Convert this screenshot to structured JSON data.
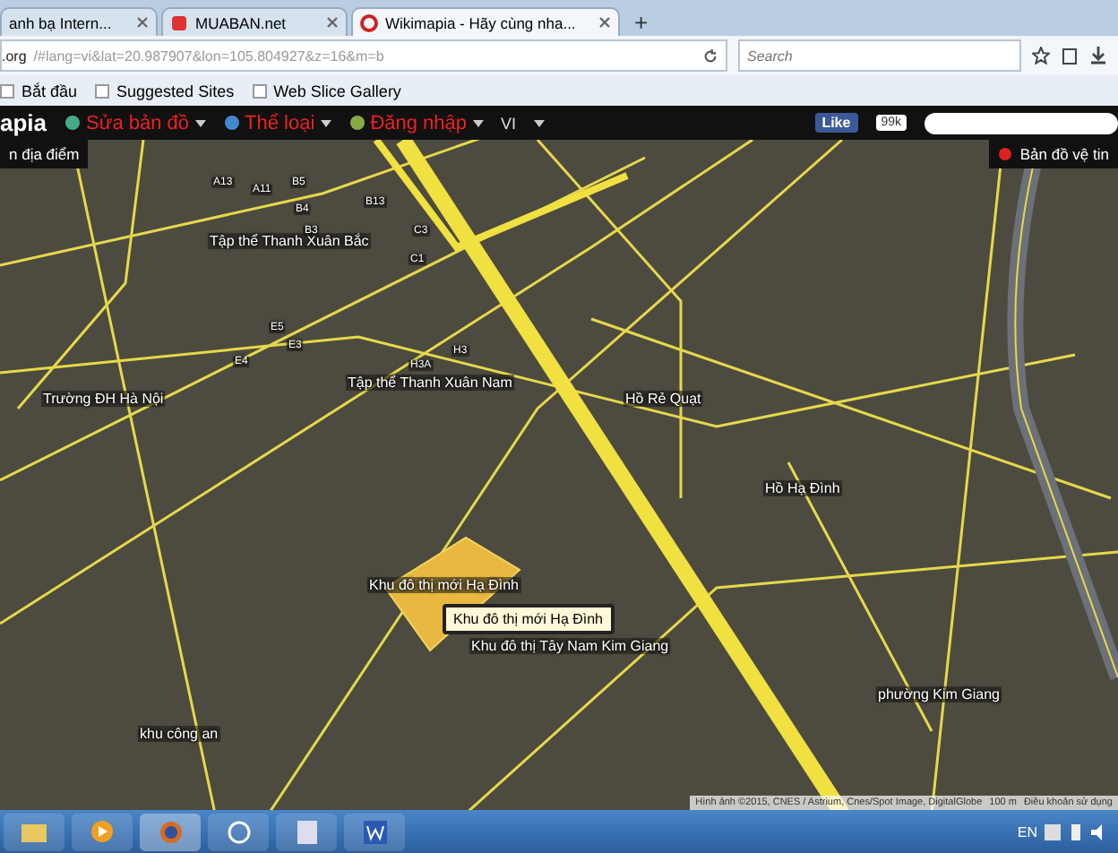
{
  "browser": {
    "tabs": [
      {
        "label": "anh bạ Intern...",
        "selected": false
      },
      {
        "label": "MUABAN.net",
        "selected": false
      },
      {
        "label": "Wikimapia - Hãy cùng nha...",
        "selected": true
      }
    ],
    "new_tab": "+",
    "address": {
      "host": ".org",
      "path": "/#lang=vi&lat=20.987907&lon=105.804927&z=16&m=b"
    },
    "search": {
      "placeholder": "Search"
    },
    "bookmarks": [
      "Bắt đầu",
      "Suggested Sites",
      "Web Slice Gallery"
    ]
  },
  "site_bar": {
    "logo": "apia",
    "menu": [
      "Sửa bản đồ",
      "Thể loại",
      "Đăng nhập"
    ],
    "language": "VI",
    "like": "Like",
    "like_count": "99k"
  },
  "map": {
    "left_button": "n địa điểm",
    "right_button": "Bản đồ vệ tin",
    "labels": [
      "Tập thể Thanh Xuân Bắc",
      "Tập thể Thanh Xuân Nam",
      "Trường ĐH Hà Nội",
      "Hồ Rẻ Quạt",
      "Hồ Hạ Đình",
      "Khu đô thị mới Hạ Đình",
      "Khu đô thị Tây Nam Kim Giang",
      "phường Kim Giang",
      "khu công an",
      "A13",
      "A11",
      "B5",
      "B4",
      "B3",
      "B13",
      "C3",
      "C1",
      "E5",
      "E4",
      "E3",
      "H3",
      "H3A"
    ],
    "tooltip": "Khu đô thị mới Hạ Đình",
    "attribution": "Hình ảnh ©2015, CNES / Astrium, Cnes/Spot Image, DigitalGlobe",
    "scale": "100 m",
    "terms": "Điều khoản sử dụng"
  },
  "taskbar": {
    "language": "EN"
  }
}
